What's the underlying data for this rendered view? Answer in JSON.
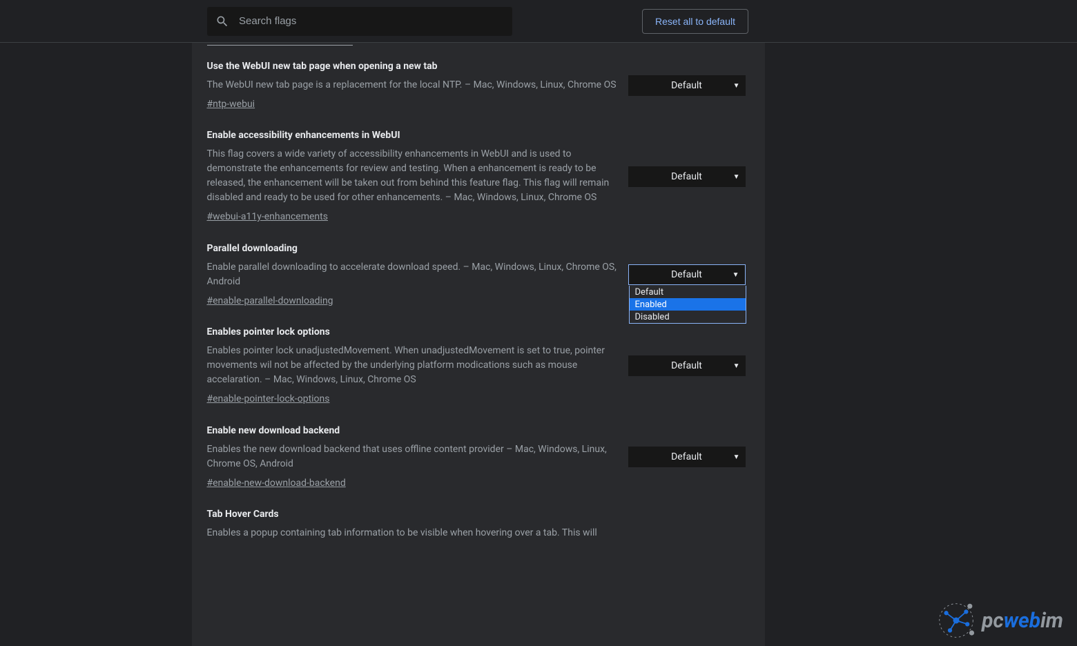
{
  "header": {
    "search_placeholder": "Search flags",
    "reset_label": "Reset all to default"
  },
  "dropdown_options": [
    "Default",
    "Enabled",
    "Disabled"
  ],
  "flags": [
    {
      "title": "Use the WebUI new tab page when opening a new tab",
      "desc": "The WebUI new tab page is a replacement for the local NTP. – Mac, Windows, Linux, Chrome OS",
      "link": "#ntp-webui",
      "value": "Default",
      "open": false
    },
    {
      "title": "Enable accessibility enhancements in WebUI",
      "desc": "This flag covers a wide variety of accessibility enhancements in WebUI and is used to demonstrate the enhancements for review and testing. When a enhancement is ready to be released, the enhancement will be taken out from behind this feature flag. This flag will remain disabled and ready to be used for other enhancements. – Mac, Windows, Linux, Chrome OS",
      "link": "#webui-a11y-enhancements",
      "value": "Default",
      "open": false
    },
    {
      "title": "Parallel downloading",
      "desc": "Enable parallel downloading to accelerate download speed. – Mac, Windows, Linux, Chrome OS, Android",
      "link": "#enable-parallel-downloading",
      "value": "Default",
      "open": true,
      "highlight": "Enabled"
    },
    {
      "title": "Enables pointer lock options",
      "desc": "Enables pointer lock unadjustedMovement. When unadjustedMovement is set to true, pointer movements wil not be affected by the underlying platform modications such as mouse accelaration. – Mac, Windows, Linux, Chrome OS",
      "link": "#enable-pointer-lock-options",
      "value": "Default",
      "open": false
    },
    {
      "title": "Enable new download backend",
      "desc": "Enables the new download backend that uses offline content provider – Mac, Windows, Linux, Chrome OS, Android",
      "link": "#enable-new-download-backend",
      "value": "Default",
      "open": false
    },
    {
      "title": "Tab Hover Cards",
      "desc": "Enables a popup containing tab information to be visible when hovering over a tab. This will",
      "link": "",
      "value": "",
      "open": false,
      "cut": true
    }
  ],
  "watermark": {
    "prefix": "pc",
    "mid": "web",
    "suffix": "im"
  }
}
